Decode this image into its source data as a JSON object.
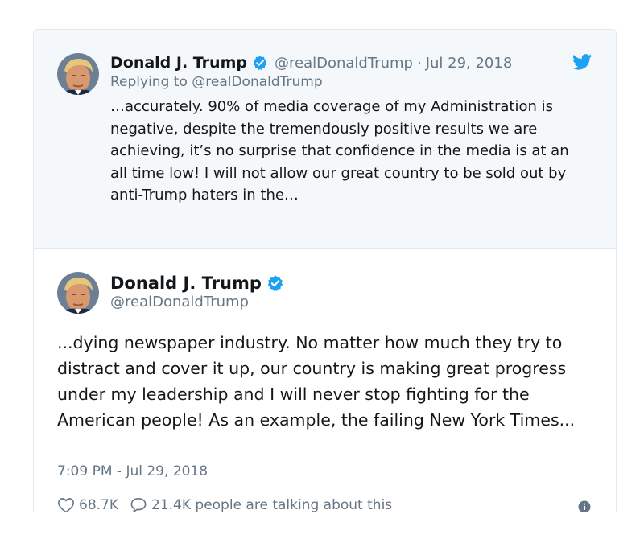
{
  "parent_tweet": {
    "author_name": "Donald J. Trump",
    "handle": "@realDonaldTrump",
    "separator": "·",
    "date": "Jul 29, 2018",
    "replying_to": "Replying to @realDonaldTrump",
    "text": "…accurately. 90% of media coverage of my Administration is negative, despite the tremendously positive results we are achieving, it’s no surprise that confidence in the media is at an all time low! I will not allow our great country to be sold out by anti-Trump haters in the…"
  },
  "main_tweet": {
    "author_name": "Donald J. Trump",
    "handle": "@realDonaldTrump",
    "text": "...dying newspaper industry. No matter how much they try to distract and cover it up, our country is making great progress under my leadership and I will never stop fighting for the American people! As an example, the failing New York Times...",
    "timestamp": "7:09 PM - Jul 29, 2018"
  },
  "actions": {
    "likes": "68.7K",
    "replies": "21.4K people are talking about this"
  },
  "icons": {
    "verified": "verified-badge-icon",
    "twitter": "twitter-bird-icon",
    "like": "heart-icon",
    "reply": "speech-bubble-icon",
    "info": "info-icon"
  },
  "colors": {
    "twitter_blue": "#1da1f2",
    "secondary_text": "#657786",
    "primary_text": "#14171a",
    "parent_background": "#f5f8fa",
    "border": "#e1e8ed"
  }
}
